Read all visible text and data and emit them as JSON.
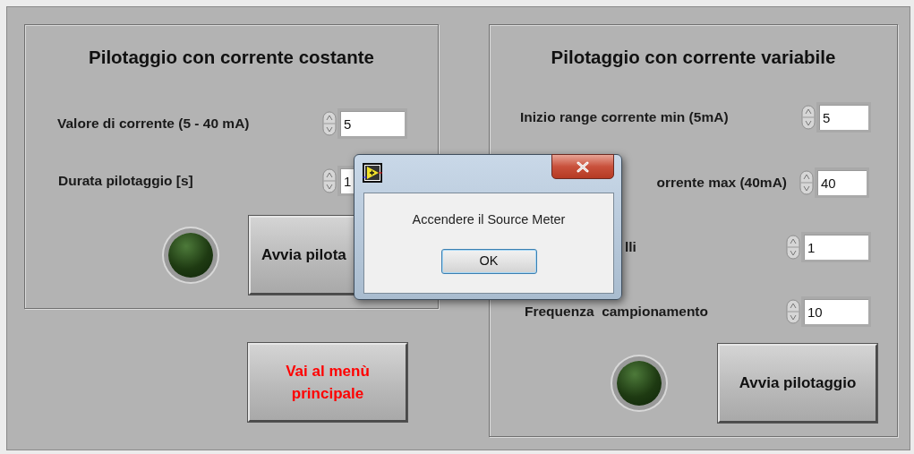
{
  "left_panel": {
    "title": "Pilotaggio con corrente costante",
    "fields": [
      {
        "label": "Valore di corrente (5 - 40 mA)",
        "value": "5"
      },
      {
        "label": "Durata pilotaggio [s]",
        "value": "1"
      }
    ],
    "led": {
      "on": false
    },
    "start_button": "Avvia pilota"
  },
  "menu_button": "Vai al menù principale",
  "right_panel": {
    "title": "Pilotaggio con corrente variabile",
    "fields": [
      {
        "label": "Inizio range corrente min (5mA)",
        "value": "5"
      },
      {
        "label": "orrente max (40mA)",
        "value": "40"
      },
      {
        "label": "lli",
        "value": "1"
      },
      {
        "label": "Frequenza  campionamento",
        "value": "10"
      }
    ],
    "led": {
      "on": false
    },
    "start_button": "Avvia pilotaggio"
  },
  "dialog": {
    "message": "Accendere il Source Meter",
    "ok_button": "OK"
  }
}
